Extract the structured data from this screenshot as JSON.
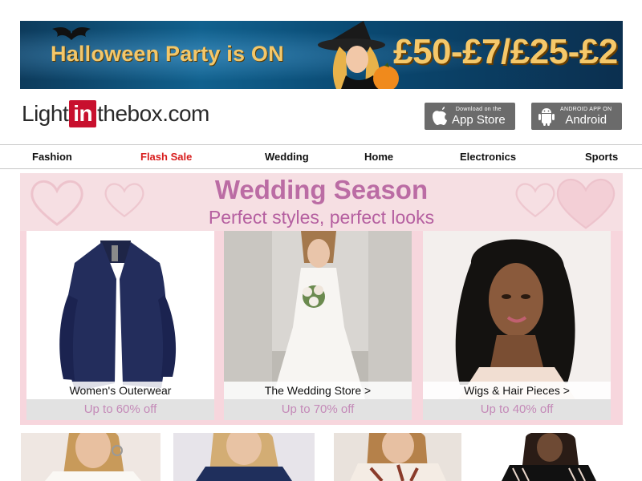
{
  "promo": {
    "headline": "Halloween Party is ON",
    "deal": "£50-£7/£25-£2"
  },
  "header": {
    "logo": {
      "part1": "Light",
      "part2": "in",
      "part3": "thebox",
      "suffix": ".com"
    },
    "app_store": {
      "small": "Download on the",
      "big": "App Store"
    },
    "android": {
      "small": "ANDROID APP ON",
      "big": "Android"
    }
  },
  "nav": {
    "items": [
      "Fashion",
      "Flash Sale",
      "Wedding",
      "Home",
      "Electronics",
      "Sports"
    ]
  },
  "wedding": {
    "title": "Wedding Season",
    "subtitle": "Perfect styles, perfect looks",
    "cards": [
      {
        "label": "Women's Outerwear",
        "offer": "Up to 60% off"
      },
      {
        "label": "The Wedding Store >",
        "offer": "Up to 70% off"
      },
      {
        "label": "Wigs & Hair Pieces >",
        "offer": "Up to 40% off"
      }
    ]
  },
  "colors": {
    "flash_sale": "#d81e1e",
    "wedding_title": "#bb6ca4",
    "offer_text": "#c48ab8",
    "nav_border": "#c8c8c8"
  }
}
